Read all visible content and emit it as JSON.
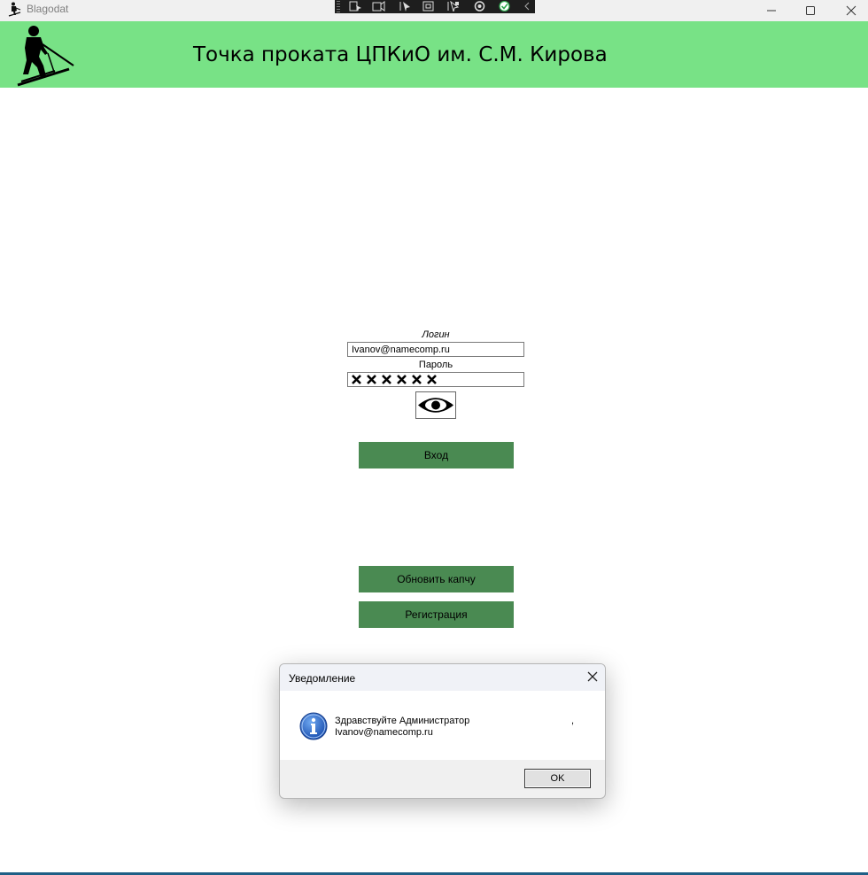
{
  "window": {
    "title": "Blagodat",
    "icon": "skier-icon",
    "controls": [
      "minimize-icon",
      "maximize-icon",
      "close-icon"
    ]
  },
  "debug_toolbar": {
    "icons": [
      "select-element-icon",
      "live-visual-tree-icon",
      "pointer-icon",
      "layout-adorner-icon",
      "track-focus-icon",
      "binding-failures-icon",
      "hot-reload-ok-icon",
      "collapse-icon"
    ]
  },
  "header": {
    "title": "Точка проката ЦПКиО им. С.М. Кирова",
    "background": "#78e286",
    "logo": "skier-logo"
  },
  "login_form": {
    "login_label": "Логин",
    "login_value": "Ivanov@namecomp.ru",
    "password_label": "Пароль",
    "password_masked_chars": 6,
    "show_password_icon": "eye-icon"
  },
  "buttons": {
    "login": "Вход",
    "refresh_captcha": "Обновить капчу",
    "register": "Регистрация",
    "color": "#4a8a52"
  },
  "dialog": {
    "title": "Уведомление",
    "icon": "info-icon",
    "message_line1": "Здравствуйте Администратор",
    "message_line2": "Ivanov@namecomp.ru",
    "message_trailing": ",",
    "ok_label": "OK"
  }
}
